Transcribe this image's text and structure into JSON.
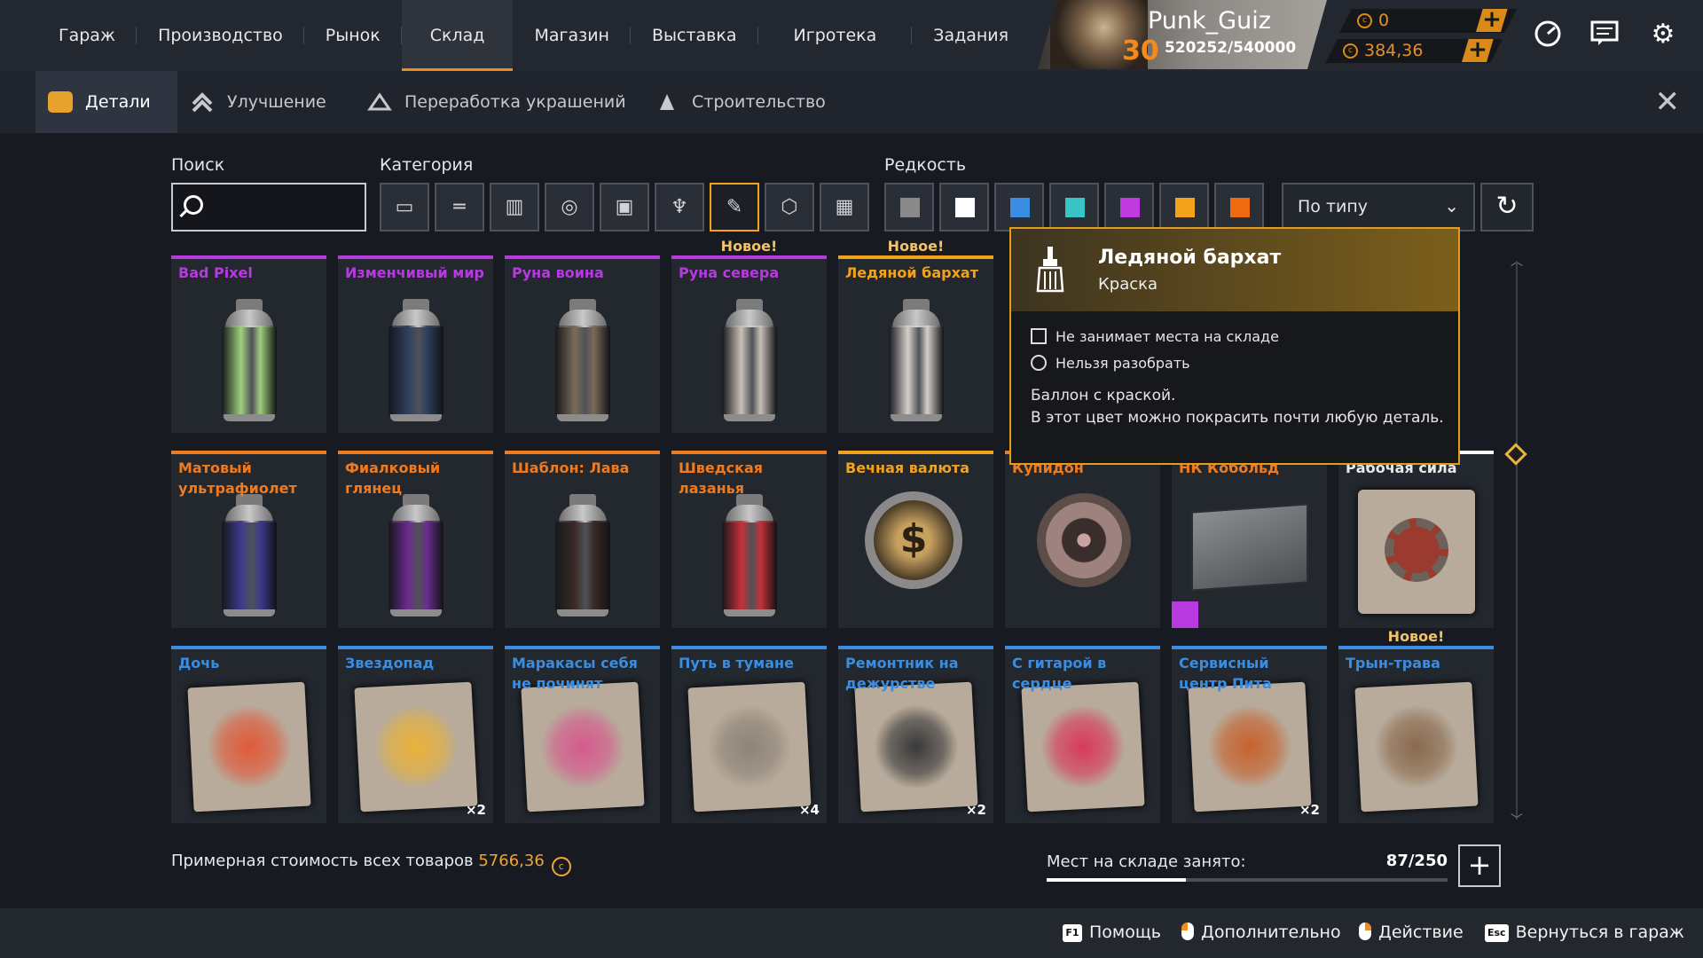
{
  "colors": {
    "accent": "#f08c1e",
    "purple": "#b63ae0",
    "orange": "#f07a1e",
    "gold": "#f2a31b",
    "blue": "#3a8de0"
  },
  "nav": {
    "items": [
      "Гараж",
      "Производство",
      "Рынок",
      "Склад",
      "Магазин",
      "Выставка",
      "Игротека",
      "Задания"
    ],
    "active_index": 3
  },
  "profile": {
    "name": "Punk_Guiz",
    "level": "30",
    "xp": "520252/540000"
  },
  "currency": {
    "coins": "0",
    "crowns": "384,36"
  },
  "subtabs": [
    {
      "label": "Детали",
      "icon": "parts-icon"
    },
    {
      "label": "Улучшение",
      "icon": "upgrade-icon"
    },
    {
      "label": "Переработка украшений",
      "icon": "recycle-decor-icon"
    },
    {
      "label": "Строительство",
      "icon": "construction-icon"
    }
  ],
  "filters": {
    "search_label": "Поиск",
    "search_value": "",
    "category_label": "Категория",
    "categories": [
      "cabin-icon",
      "weapon-icon",
      "module-icon",
      "wheel-icon",
      "frame-icon",
      "decor-icon",
      "paint-icon",
      "hardware-icon",
      "grid-icon"
    ],
    "active_category": 6,
    "rarity_label": "Редкость",
    "rarity_colors": [
      "#8a8a8a",
      "#ffffff",
      "#3a8de0",
      "#38c4c4",
      "#c13ae0",
      "#f2a31b",
      "#f06a12"
    ],
    "sort_value": "По типу"
  },
  "items": [
    {
      "name": "Bad Pixel",
      "rarity": "#b63ae0",
      "kind": "can",
      "pattern": "#9fcf7e",
      "new": "",
      "count": ""
    },
    {
      "name": "Изменчивый мир",
      "rarity": "#b63ae0",
      "kind": "can",
      "pattern": "#2f3f5e",
      "new": "",
      "count": ""
    },
    {
      "name": "Руна воина",
      "rarity": "#b63ae0",
      "kind": "can",
      "pattern": "#7b6a58",
      "new": "",
      "count": ""
    },
    {
      "name": "Руна севера",
      "rarity": "#b63ae0",
      "kind": "can",
      "pattern": "#c9c0b6",
      "new": "Новое!",
      "count": ""
    },
    {
      "name": "Ледяной бархат",
      "rarity": "#f2a31b",
      "kind": "can",
      "pattern": "#d4cfcb",
      "new": "Новое!",
      "count": ""
    },
    {
      "name": "",
      "rarity": "#f2a31b",
      "kind": "hidden",
      "pattern": "",
      "new": "",
      "count": ""
    },
    {
      "name": "",
      "rarity": "#f2a31b",
      "kind": "hidden",
      "pattern": "",
      "new": "",
      "count": ""
    },
    {
      "name": "",
      "rarity": "#f2a31b",
      "kind": "hidden",
      "pattern": "",
      "new": "",
      "count": ""
    },
    {
      "name": "Матовый ультрафиолет",
      "rarity": "#f07a1e",
      "kind": "can",
      "pattern": "#3e3a8c",
      "new": "",
      "count": ""
    },
    {
      "name": "Фиалковый глянец",
      "rarity": "#f07a1e",
      "kind": "can",
      "pattern": "#6a2c8e",
      "new": "",
      "count": ""
    },
    {
      "name": "Шаблон: Лава",
      "rarity": "#f07a1e",
      "kind": "can",
      "pattern": "#3a2a26",
      "new": "",
      "count": ""
    },
    {
      "name": "Шведская лазанья",
      "rarity": "#f07a1e",
      "kind": "can",
      "pattern": "#c6303a",
      "new": "",
      "count": ""
    },
    {
      "name": "Вечная валюта",
      "rarity": "#f2a31b",
      "kind": "coin",
      "pattern": "",
      "new": "",
      "count": ""
    },
    {
      "name": "Купидон",
      "rarity": "#f07a1e",
      "kind": "wheel",
      "pattern": "",
      "new": "",
      "count": ""
    },
    {
      "name": "НК Кобольд",
      "rarity": "#f07a1e",
      "kind": "box",
      "pattern": "",
      "new": "",
      "count": ""
    },
    {
      "name": "Рабочая сила",
      "rarity": "#ffffff",
      "kind": "gear",
      "pattern": "",
      "new": "",
      "count": ""
    },
    {
      "name": "Дочь",
      "rarity": "#3a8de0",
      "kind": "sticker",
      "pattern": "#e05a3a",
      "new": "",
      "count": ""
    },
    {
      "name": "Звездопад",
      "rarity": "#3a8de0",
      "kind": "sticker",
      "pattern": "#e8b23a",
      "new": "",
      "count": "×2"
    },
    {
      "name": "Маракасы себя не починят",
      "rarity": "#3a8de0",
      "kind": "sticker",
      "pattern": "#d65a8e",
      "new": "",
      "count": ""
    },
    {
      "name": "Путь в тумане",
      "rarity": "#3a8de0",
      "kind": "sticker",
      "pattern": "#8e8478",
      "new": "",
      "count": "×4"
    },
    {
      "name": "Ремонтник на дежурстве",
      "rarity": "#3a8de0",
      "kind": "sticker",
      "pattern": "#3a3a3a",
      "new": "",
      "count": "×2"
    },
    {
      "name": "С гитарой в сердце",
      "rarity": "#3a8de0",
      "kind": "sticker",
      "pattern": "#d83a5a",
      "new": "",
      "count": ""
    },
    {
      "name": "Сервисный центр Пита",
      "rarity": "#3a8de0",
      "kind": "sticker",
      "pattern": "#c7622e",
      "new": "",
      "count": "×2"
    },
    {
      "name": "Трын-трава",
      "rarity": "#3a8de0",
      "kind": "sticker",
      "pattern": "#8a6a4e",
      "new": "Новое!",
      "count": ""
    }
  ],
  "tooltip": {
    "title": "Ледяной бархат",
    "subtitle": "Краска",
    "prop1": "Не занимает места на складе",
    "prop2": "Нельзя разобрать",
    "desc_line1": "Баллон с краской.",
    "desc_line2": "В этот цвет можно покрасить почти любую деталь."
  },
  "bottom": {
    "value_label": "Примерная стоимость всех товаров",
    "value": "5766,36",
    "capacity_label": "Мест на складе занято:",
    "capacity": "87/250",
    "capacity_fraction": 0.348
  },
  "hints": [
    {
      "key": "F1",
      "label": "Помощь"
    },
    {
      "key": "mouse-l",
      "label": "Дополнительно"
    },
    {
      "key": "mouse-r",
      "label": "Действие"
    },
    {
      "key": "Esc",
      "label": "Вернуться в гараж"
    }
  ]
}
